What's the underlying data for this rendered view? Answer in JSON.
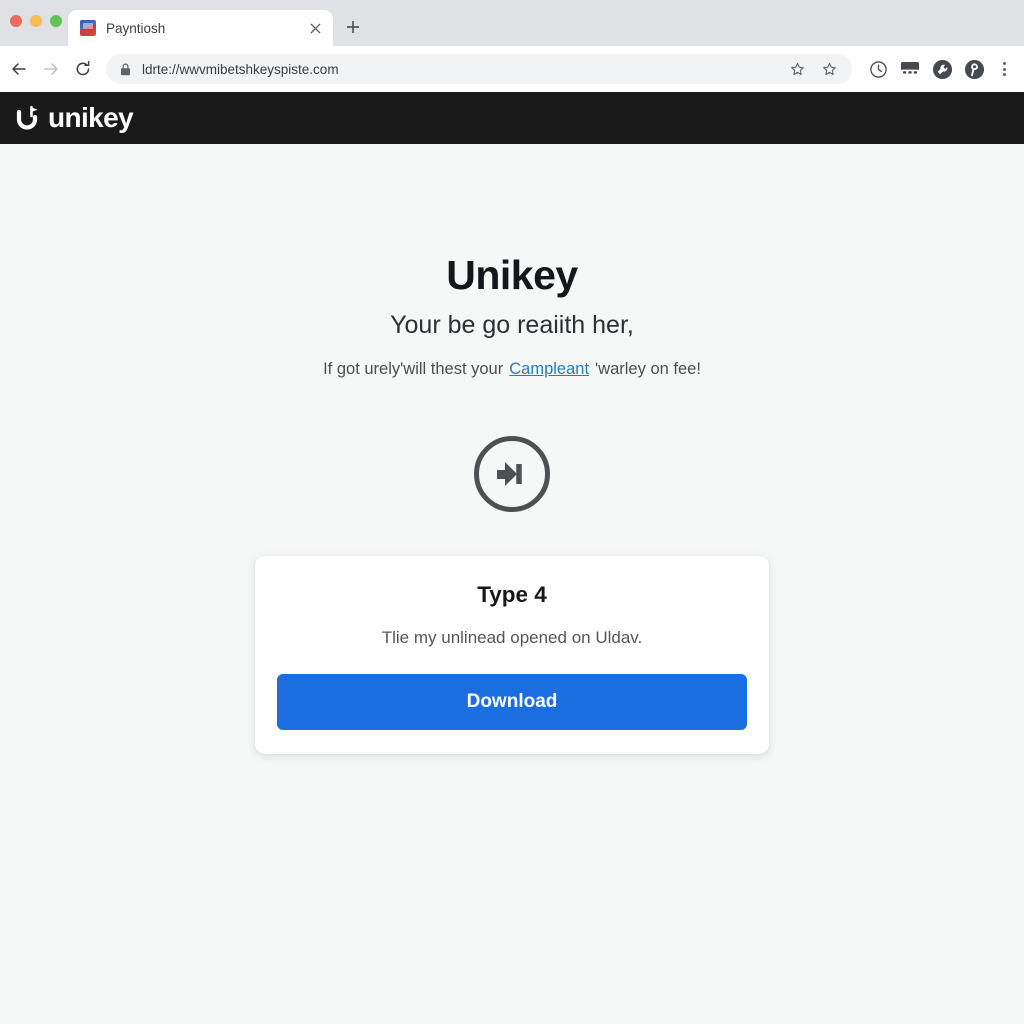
{
  "browser": {
    "traffic_lights": [
      {
        "name": "close-window-button",
        "color": "#ee6a5f"
      },
      {
        "name": "minimize-window-button",
        "color": "#f5bf4f"
      },
      {
        "name": "maximize-window-button",
        "color": "#61c554"
      }
    ],
    "tab": {
      "title": "Payntiosh",
      "favicon": "site-favicon",
      "close_label": "×"
    },
    "new_tab_label": "+",
    "nav": {
      "back_label": "←",
      "forward_label": "→",
      "reload_label": "↻"
    },
    "omnibox": {
      "url": "ldrte://wwvmibetshkeyspiste.com",
      "lock_icon": "lock-icon",
      "star_icons": [
        "bookmark-star-outline-icon",
        "bookmark-star-icon"
      ]
    },
    "toolbar_icons": [
      "history-clock-icon",
      "extensions-panel-icon",
      "tools-wrench-icon",
      "profile-avatar-icon"
    ],
    "menu_label": "⋮"
  },
  "site": {
    "header": {
      "logo_mark": "unikey-u-logo-icon",
      "logo_text": "unikey",
      "background": "#1a1a1a"
    },
    "hero": {
      "title": "Unikey",
      "subtitle": "Your be go reaiith her,",
      "note_before": "If got urely'will thest your",
      "note_link": "Campleant",
      "note_after": "'warley on fee!",
      "link_color": "#2b7bb9"
    },
    "status_icon": "circle-arrow-icon",
    "card": {
      "title": "Type 4",
      "subtitle": "Tlie my unlinead opened on Uldav.",
      "button_label": "Download",
      "button_color": "#1b6ee0"
    }
  }
}
